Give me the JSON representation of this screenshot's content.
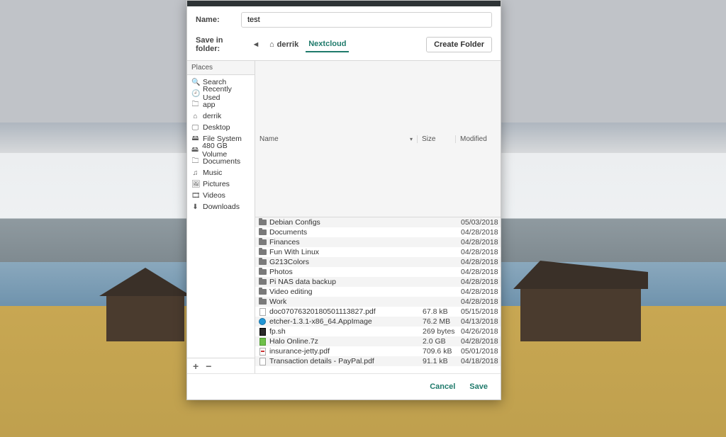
{
  "name_field": {
    "label": "Name:",
    "value": "test"
  },
  "save_in": {
    "label": "Save in folder:",
    "back_glyph": "◄",
    "crumbs": [
      {
        "label": "derrik",
        "icon": "home-icon",
        "active": false
      },
      {
        "label": "Nextcloud",
        "active": true
      }
    ]
  },
  "create_folder_label": "Create Folder",
  "places_header": "Places",
  "places": [
    {
      "icon": "search-icon",
      "glyph": "🔍",
      "label": "Search"
    },
    {
      "icon": "recent-icon",
      "glyph": "🕘",
      "label": "Recently Used"
    },
    {
      "icon": "folder-icon",
      "glyph": "🗀",
      "label": "app"
    },
    {
      "icon": "home-icon",
      "glyph": "⌂",
      "label": "derrik"
    },
    {
      "icon": "desktop-icon",
      "glyph": "🖵",
      "label": "Desktop"
    },
    {
      "icon": "disk-icon",
      "glyph": "🖴",
      "label": "File System"
    },
    {
      "icon": "disk-icon",
      "glyph": "🖴",
      "label": "480 GB Volume"
    },
    {
      "icon": "folder-icon",
      "glyph": "🗀",
      "label": "Documents"
    },
    {
      "icon": "music-icon",
      "glyph": "♫",
      "label": "Music"
    },
    {
      "icon": "pictures-icon",
      "glyph": "🖼",
      "label": "Pictures"
    },
    {
      "icon": "videos-icon",
      "glyph": "🎞",
      "label": "Videos"
    },
    {
      "icon": "downloads-icon",
      "glyph": "⬇",
      "label": "Downloads"
    }
  ],
  "places_footer": {
    "add_glyph": "+",
    "remove_glyph": "−"
  },
  "columns": {
    "name": "Name",
    "size": "Size",
    "modified": "Modified",
    "sort_glyph": "▾"
  },
  "files": [
    {
      "type": "folder",
      "name": "Debian Configs",
      "size": "",
      "modified": "05/03/2018"
    },
    {
      "type": "folder",
      "name": "Documents",
      "size": "",
      "modified": "04/28/2018"
    },
    {
      "type": "folder",
      "name": "Finances",
      "size": "",
      "modified": "04/28/2018"
    },
    {
      "type": "folder",
      "name": "Fun With Linux",
      "size": "",
      "modified": "04/28/2018"
    },
    {
      "type": "folder",
      "name": "G213Colors",
      "size": "",
      "modified": "04/28/2018"
    },
    {
      "type": "folder",
      "name": "Photos",
      "size": "",
      "modified": "04/28/2018"
    },
    {
      "type": "folder",
      "name": "Pi NAS data backup",
      "size": "",
      "modified": "04/28/2018"
    },
    {
      "type": "folder",
      "name": "Video editing",
      "size": "",
      "modified": "04/28/2018"
    },
    {
      "type": "folder",
      "name": "Work",
      "size": "",
      "modified": "04/28/2018"
    },
    {
      "type": "doc",
      "name": "doc07076320180501113827.pdf",
      "size": "67.8 kB",
      "modified": "05/15/2018"
    },
    {
      "type": "appimage",
      "name": "etcher-1.3.1-x86_64.AppImage",
      "size": "76.2 MB",
      "modified": "04/13/2018"
    },
    {
      "type": "sh",
      "name": "fp.sh",
      "size": "269 bytes",
      "modified": "04/26/2018"
    },
    {
      "type": "zip",
      "name": "Halo Online.7z",
      "size": "2.0 GB",
      "modified": "04/28/2018"
    },
    {
      "type": "pdf",
      "name": "insurance-jetty.pdf",
      "size": "709.6 kB",
      "modified": "05/01/2018"
    },
    {
      "type": "doc",
      "name": "Transaction details - PayPal.pdf",
      "size": "91.1 kB",
      "modified": "04/18/2018"
    }
  ],
  "footer": {
    "cancel": "Cancel",
    "save": "Save"
  }
}
